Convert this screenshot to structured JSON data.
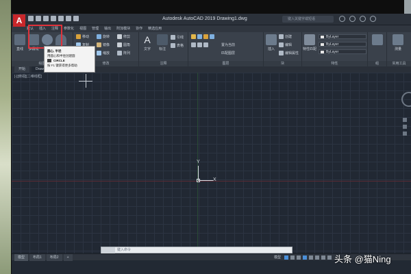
{
  "window": {
    "title": "Autodesk AutoCAD 2019   Drawing1.dwg",
    "app_logo": "A",
    "search_placeholder": "键入关键字或短语"
  },
  "ribbon_tabs": [
    "默认",
    "插入",
    "注释",
    "参数化",
    "视图",
    "管理",
    "输出",
    "附加模块",
    "协作",
    "精选应用"
  ],
  "ribbon": {
    "draw_panel_label": "绘图",
    "draw_tools": [
      "直线",
      "多段线",
      "圆",
      "圆弧"
    ],
    "modify_panel_label": "修改",
    "modify_tools": [
      "移动",
      "旋转",
      "修剪",
      "复制",
      "镜像",
      "圆角",
      "拉伸",
      "缩放",
      "阵列"
    ],
    "annotation_panel_label": "注释",
    "annotation_tools": [
      "文字",
      "标注",
      "引线",
      "表格"
    ],
    "layers_panel_label": "图层",
    "layer_tools": [
      "置为当前",
      "匹配图层"
    ],
    "block_panel_label": "块",
    "block_tools": [
      "插入",
      "创建",
      "编辑",
      "编辑属性"
    ],
    "properties_panel_label": "特性",
    "properties_tools": [
      "特性匹配"
    ],
    "bylayer_values": [
      "ByLayer",
      "ByLayer",
      "ByLayer"
    ],
    "groups_panel_label": "组",
    "utilities_panel_label": "实用工具",
    "utilities_tools": [
      "测量"
    ]
  },
  "tooltip": {
    "title": "圆心, 半径",
    "description": "用圆心和半径创建圆",
    "command": "CIRCLE",
    "help": "按 F1 键获得更多帮助"
  },
  "file_tabs": [
    "开始",
    "Drawing1*"
  ],
  "viewport_label": "[-][俯视][二维线框]",
  "ucs": {
    "y": "Y",
    "x": "X"
  },
  "command_line": {
    "placeholder": "键入命令"
  },
  "layout_tabs": [
    "模型",
    "布局1",
    "布局2"
  ],
  "status": {
    "model": "模型"
  },
  "watermark": "头条 @猫Ning"
}
